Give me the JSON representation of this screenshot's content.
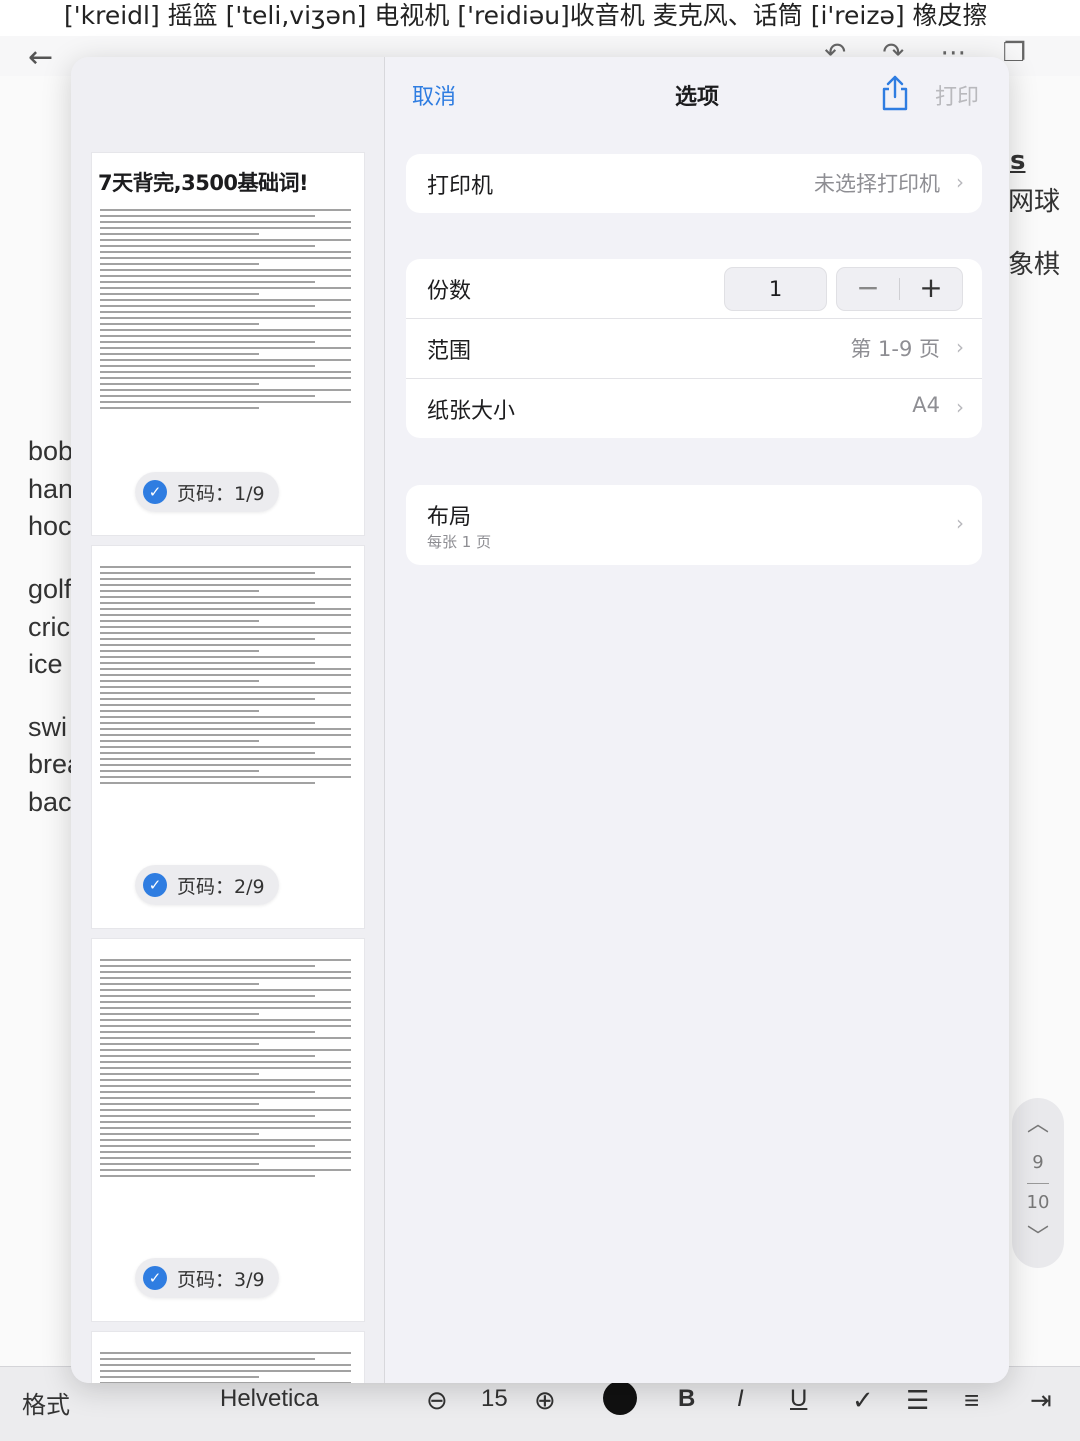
{
  "background": {
    "top_line": "['kreidl] 摇篮 ['teli,viʒən] 电视机 ['reidiəu]收音机  麦克风、话筒    [i'reizə] 橡皮擦",
    "left_words": [
      "bob",
      "han",
      "hoc",
      "golf",
      "cric",
      "ice",
      "swi",
      "brea",
      "bac"
    ],
    "right_words": [
      "s",
      "网球",
      "象棋"
    ],
    "pager": {
      "current": "9",
      "total": "10"
    },
    "format_bar": {
      "format_label": "格式",
      "font_name": "Helvetica",
      "font_size": "15",
      "bold": "B",
      "italic": "I",
      "underline": "U"
    }
  },
  "dialog": {
    "cancel": "取消",
    "title": "选项",
    "print": "打印",
    "printer": {
      "label": "打印机",
      "value": "未选择打印机"
    },
    "copies": {
      "label": "份数",
      "value": "1",
      "minus": "−",
      "plus": "+"
    },
    "range": {
      "label": "范围",
      "value": "第 1-9 页"
    },
    "paper": {
      "label": "纸张大小",
      "value": "A4"
    },
    "layout": {
      "label": "布局",
      "sub": "每张 1 页"
    }
  },
  "thumbnails": [
    {
      "title": "7天背完,3500基础词!",
      "badge": "页码：1/9"
    },
    {
      "title": "",
      "badge": "页码：2/9"
    },
    {
      "title": "",
      "badge": "页码：3/9"
    },
    {
      "title": "",
      "badge": ""
    }
  ],
  "colors": {
    "accent": "#2f7de1",
    "disabled": "#b9b9bd",
    "secondary_text": "#8e8e93"
  },
  "icons": [
    "back-arrow-icon",
    "share-icon",
    "chevron-right-icon",
    "checkmark-icon",
    "chevron-up-icon",
    "chevron-down-icon"
  ]
}
